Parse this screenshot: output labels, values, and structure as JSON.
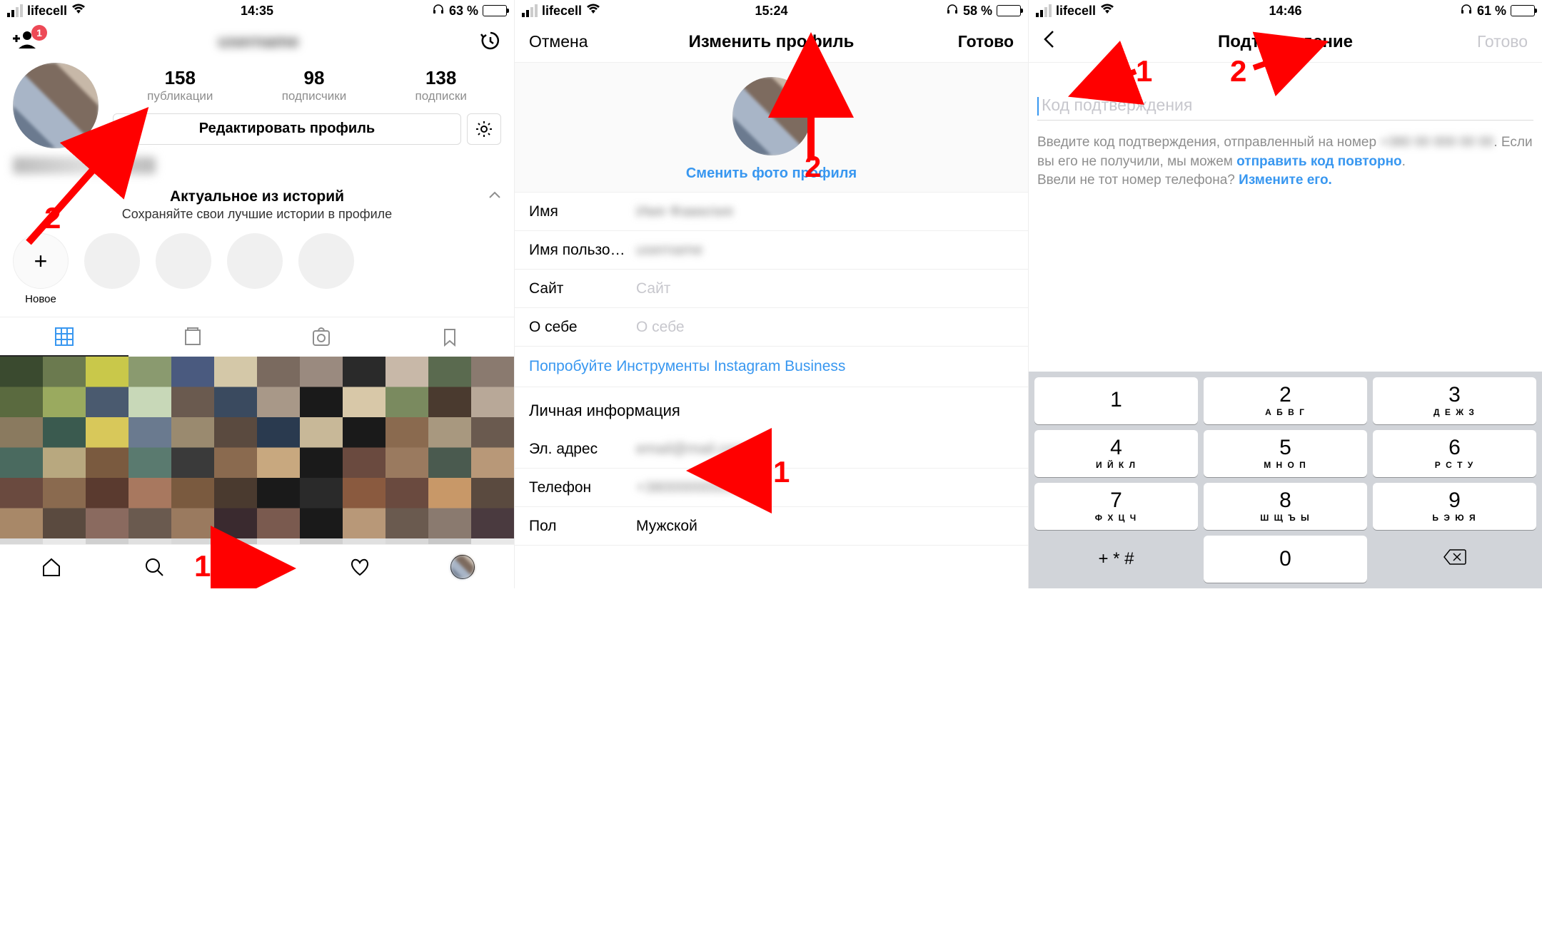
{
  "phone1": {
    "status": {
      "carrier": "lifecell",
      "time": "14:35",
      "battery_pct": "63 %"
    },
    "nav": {
      "badge": "1"
    },
    "stats": {
      "posts_n": "158",
      "posts_l": "публикации",
      "followers_n": "98",
      "followers_l": "подписчики",
      "following_n": "138",
      "following_l": "подписки"
    },
    "edit_btn": "Редактировать профиль",
    "highlights": {
      "title": "Актуальное из историй",
      "sub": "Сохраняйте свои лучшие истории в профиле",
      "new": "Новое"
    },
    "annotations": {
      "one": "1",
      "two": "2"
    }
  },
  "phone2": {
    "status": {
      "carrier": "lifecell",
      "time": "15:24",
      "battery_pct": "58 %"
    },
    "nav": {
      "cancel": "Отмена",
      "title": "Изменить профиль",
      "done": "Готово"
    },
    "change_photo": "Сменить фото профиля",
    "fields": {
      "name_l": "Имя",
      "username_l": "Имя пользо…",
      "site_l": "Сайт",
      "site_ph": "Сайт",
      "bio_l": "О себе",
      "bio_ph": "О себе"
    },
    "biz": "Попробуйте Инструменты Instagram Business",
    "section": "Личная информация",
    "private": {
      "email_l": "Эл. адрес",
      "phone_l": "Телефон",
      "gender_l": "Пол",
      "gender_v": "Мужской"
    },
    "annotations": {
      "one": "1",
      "two": "2"
    }
  },
  "phone3": {
    "status": {
      "carrier": "lifecell",
      "time": "14:46",
      "battery_pct": "61 %"
    },
    "nav": {
      "title": "Подтверждение",
      "done": "Готово"
    },
    "placeholder": "Код подтверждения",
    "help1a": "Введите код подтверждения, отправленный на номер ",
    "help1b": ". Если вы его не получили, мы можем ",
    "resend": "отправить код повторно",
    "help2a": "Ввели не тот номер телефона? ",
    "change": "Измените его.",
    "keypad": {
      "k1": {
        "n": "1",
        "s": ""
      },
      "k2": {
        "n": "2",
        "s": "А Б В Г"
      },
      "k3": {
        "n": "3",
        "s": "Д Е Ж З"
      },
      "k4": {
        "n": "4",
        "s": "И Й К Л"
      },
      "k5": {
        "n": "5",
        "s": "М Н О П"
      },
      "k6": {
        "n": "6",
        "s": "Р С Т У"
      },
      "k7": {
        "n": "7",
        "s": "Ф Х Ц Ч"
      },
      "k8": {
        "n": "8",
        "s": "Ш Щ Ъ Ы"
      },
      "k9": {
        "n": "9",
        "s": "Ь Э Ю Я"
      },
      "k0": {
        "n": "0",
        "s": ""
      },
      "sym": "+ * #"
    },
    "annotations": {
      "one": "1",
      "two": "2"
    }
  }
}
